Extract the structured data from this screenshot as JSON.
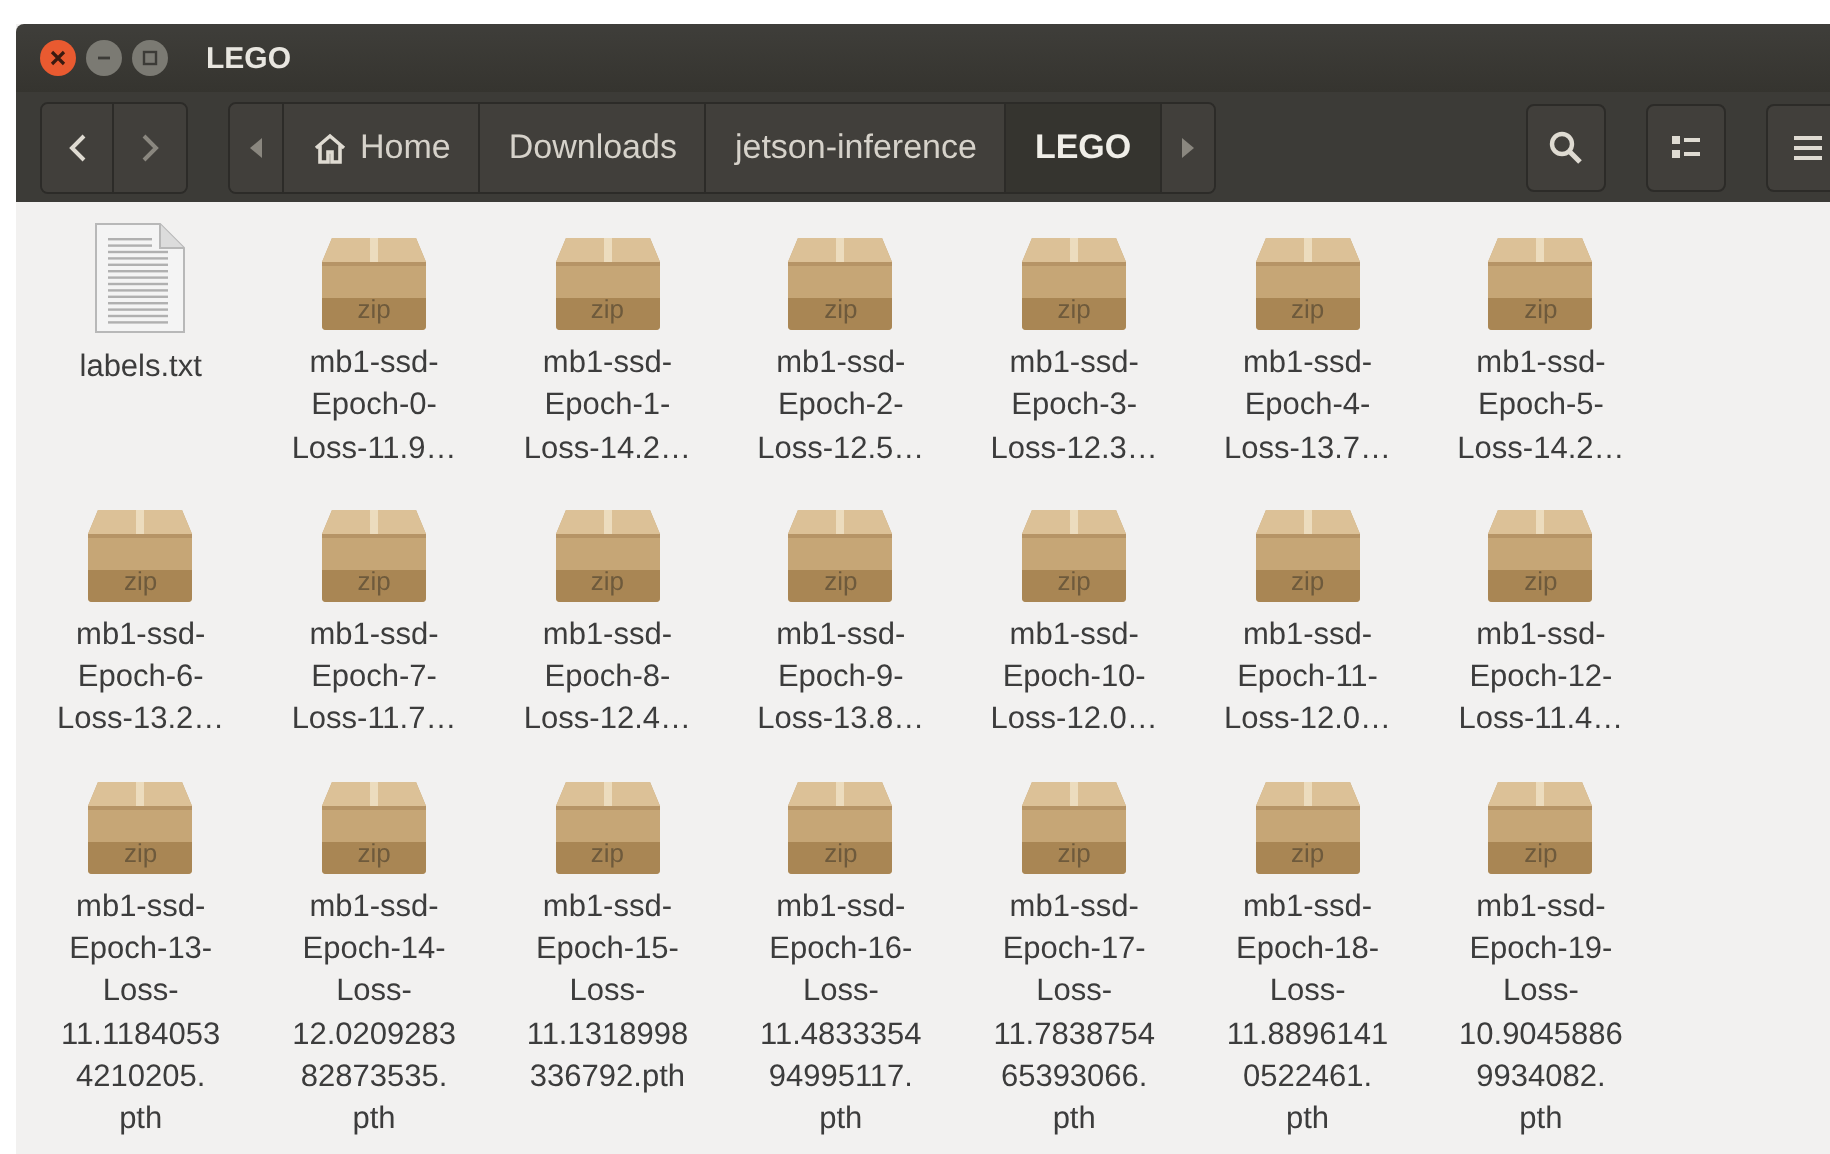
{
  "window": {
    "title": "LEGO"
  },
  "breadcrumbs": [
    {
      "label": "Home",
      "kind": "home",
      "selected": false
    },
    {
      "label": "Downloads",
      "kind": "folder",
      "selected": false
    },
    {
      "label": "jetson-inference",
      "kind": "folder",
      "selected": false
    },
    {
      "label": "LEGO",
      "kind": "folder",
      "selected": true
    }
  ],
  "files": [
    {
      "kind": "text",
      "lines": [
        "labels.txt"
      ]
    },
    {
      "kind": "zip",
      "badge": "zip",
      "lines": [
        "mb1-ssd-",
        "Epoch-0-",
        "Loss-11.9…"
      ]
    },
    {
      "kind": "zip",
      "badge": "zip",
      "lines": [
        "mb1-ssd-",
        "Epoch-1-",
        "Loss-14.2…"
      ]
    },
    {
      "kind": "zip",
      "badge": "zip",
      "lines": [
        "mb1-ssd-",
        "Epoch-2-",
        "Loss-12.5…"
      ]
    },
    {
      "kind": "zip",
      "badge": "zip",
      "lines": [
        "mb1-ssd-",
        "Epoch-3-",
        "Loss-12.3…"
      ]
    },
    {
      "kind": "zip",
      "badge": "zip",
      "lines": [
        "mb1-ssd-",
        "Epoch-4-",
        "Loss-13.7…"
      ]
    },
    {
      "kind": "zip",
      "badge": "zip",
      "lines": [
        "mb1-ssd-",
        "Epoch-5-",
        "Loss-14.2…"
      ]
    },
    {
      "kind": "zip",
      "badge": "zip",
      "lines": [
        "mb1-ssd-",
        "Epoch-6-",
        "Loss-13.2…"
      ]
    },
    {
      "kind": "zip",
      "badge": "zip",
      "lines": [
        "mb1-ssd-",
        "Epoch-7-",
        "Loss-11.7…"
      ]
    },
    {
      "kind": "zip",
      "badge": "zip",
      "lines": [
        "mb1-ssd-",
        "Epoch-8-",
        "Loss-12.4…"
      ]
    },
    {
      "kind": "zip",
      "badge": "zip",
      "lines": [
        "mb1-ssd-",
        "Epoch-9-",
        "Loss-13.8…"
      ]
    },
    {
      "kind": "zip",
      "badge": "zip",
      "lines": [
        "mb1-ssd-",
        "Epoch-10-",
        "Loss-12.0…"
      ]
    },
    {
      "kind": "zip",
      "badge": "zip",
      "lines": [
        "mb1-ssd-",
        "Epoch-11-",
        "Loss-12.0…"
      ]
    },
    {
      "kind": "zip",
      "badge": "zip",
      "lines": [
        "mb1-ssd-",
        "Epoch-12-",
        "Loss-11.4…"
      ]
    },
    {
      "kind": "zip",
      "badge": "zip",
      "lines": [
        "mb1-ssd-",
        "Epoch-13-",
        "Loss-",
        "11.1184053",
        "4210205.",
        "pth"
      ]
    },
    {
      "kind": "zip",
      "badge": "zip",
      "lines": [
        "mb1-ssd-",
        "Epoch-14-",
        "Loss-",
        "12.0209283",
        "82873535.",
        "pth"
      ]
    },
    {
      "kind": "zip",
      "badge": "zip",
      "lines": [
        "mb1-ssd-",
        "Epoch-15-",
        "Loss-",
        "11.1318998",
        "336792.pth"
      ]
    },
    {
      "kind": "zip",
      "badge": "zip",
      "lines": [
        "mb1-ssd-",
        "Epoch-16-",
        "Loss-",
        "11.4833354",
        "94995117.",
        "pth"
      ]
    },
    {
      "kind": "zip",
      "badge": "zip",
      "lines": [
        "mb1-ssd-",
        "Epoch-17-",
        "Loss-",
        "11.7838754",
        "65393066.",
        "pth"
      ]
    },
    {
      "kind": "zip",
      "badge": "zip",
      "lines": [
        "mb1-ssd-",
        "Epoch-18-",
        "Loss-",
        "11.8896141",
        "0522461.",
        "pth"
      ]
    },
    {
      "kind": "zip",
      "badge": "zip",
      "lines": [
        "mb1-ssd-",
        "Epoch-19-",
        "Loss-",
        "10.9045886",
        "9934082.",
        "pth"
      ]
    }
  ]
}
